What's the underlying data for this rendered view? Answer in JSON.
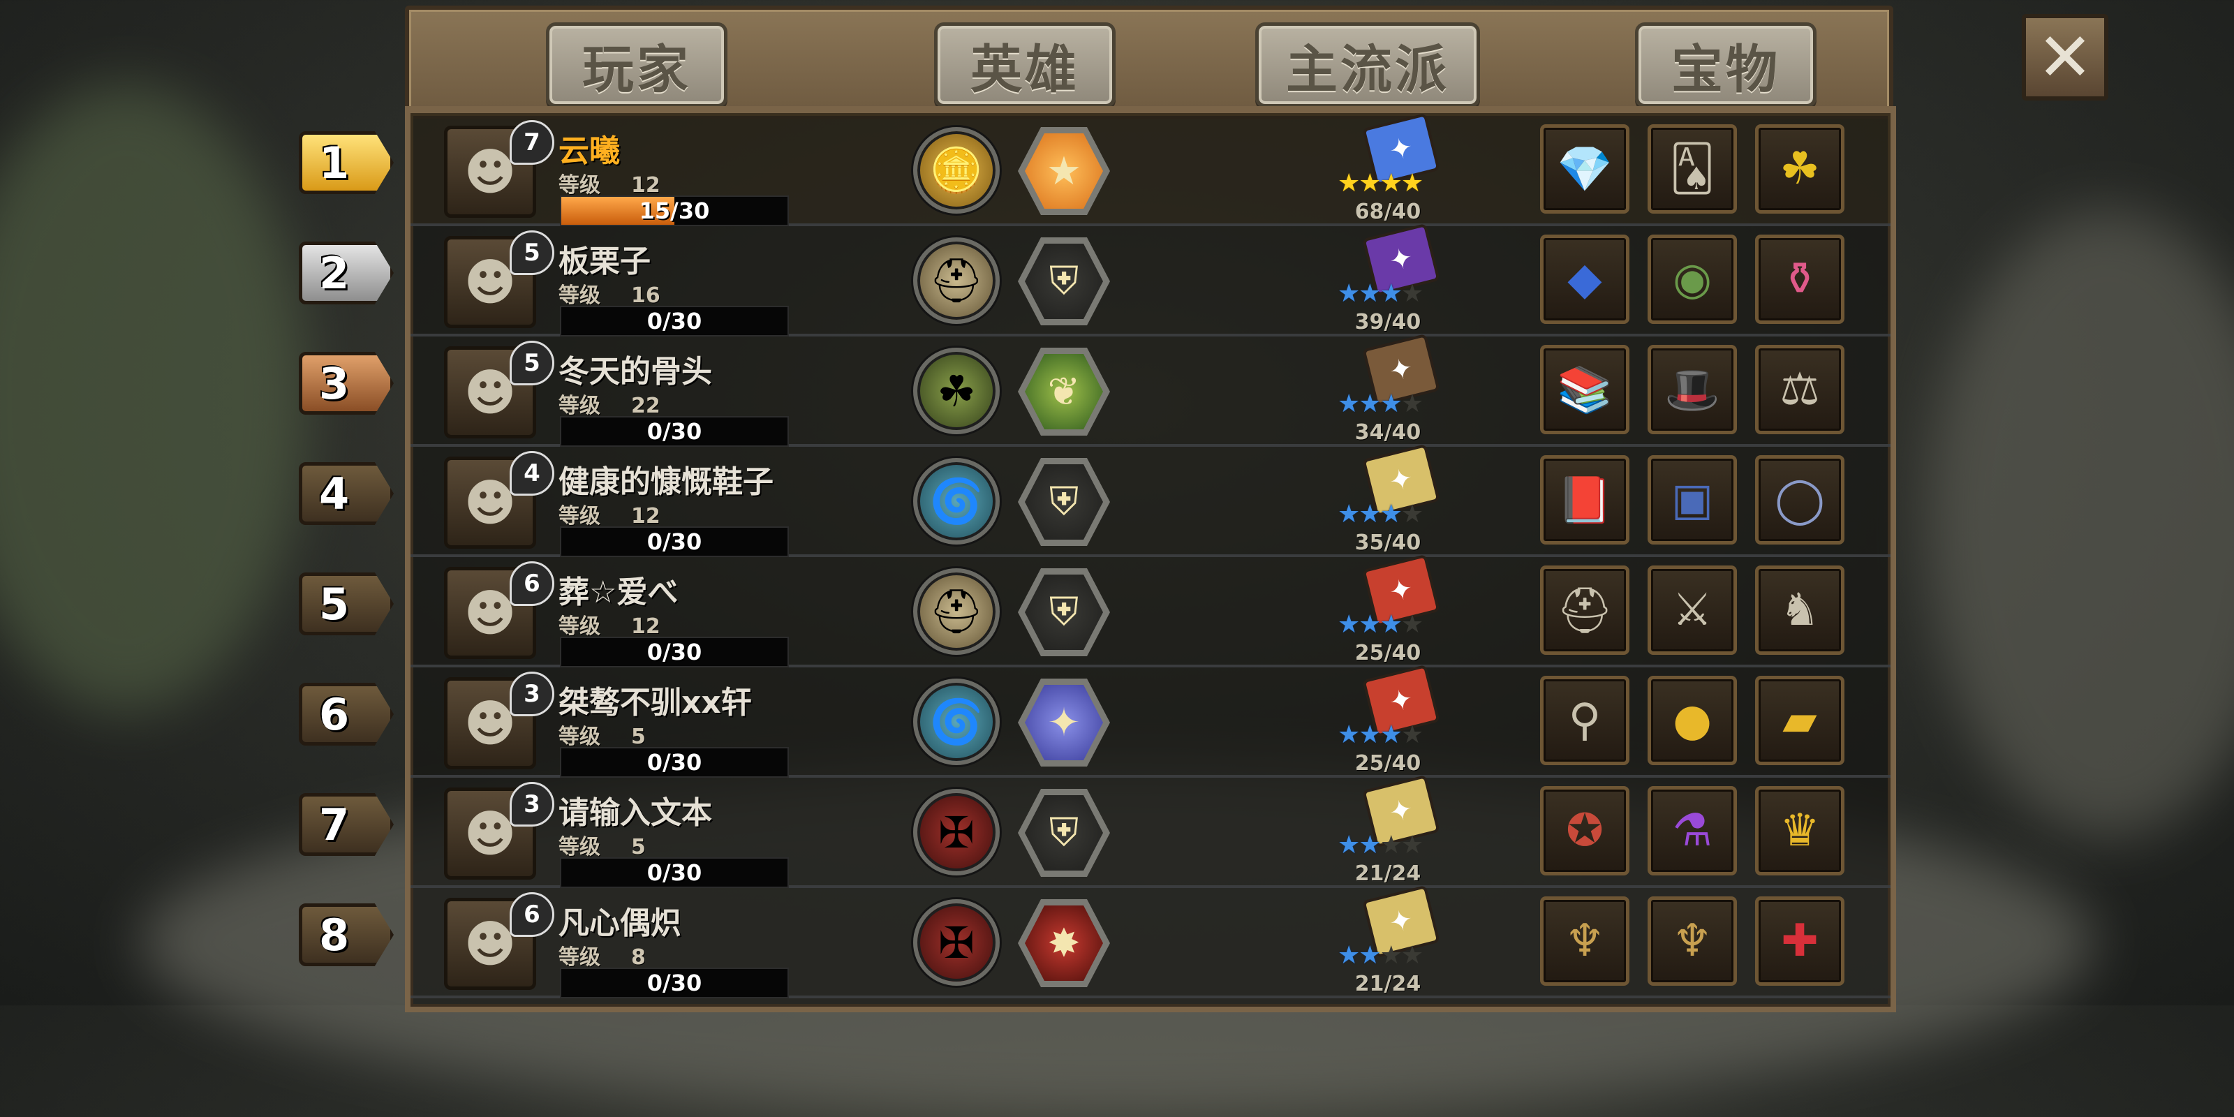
{
  "tabs": [
    {
      "label": "玩家"
    },
    {
      "label": "英雄"
    },
    {
      "label": "主流派"
    },
    {
      "label": "宝物"
    }
  ],
  "close_icon": "close-icon",
  "level_label": "等级",
  "colors": {
    "accent_gold": "#ffb020",
    "xp_fill": "#e57a20",
    "star_gold": "#ffd21e",
    "star_blue": "#3f8fe8"
  },
  "rows": [
    {
      "rank": "1",
      "name": "云曦",
      "avatar_level": "7",
      "level": "12",
      "xp": "15/30",
      "xp_fraction": 0.5,
      "hero_icon": "gold-coins-icon",
      "faction_icon": "gold-coin-hex-icon",
      "book_icon": "blue-book-icon",
      "stars": 4,
      "stars_max": 4,
      "star_color": "gold",
      "progress": "68/40",
      "treasures": [
        "crystal-ore-icon",
        "aces-cards-icon",
        "clover-icon"
      ]
    },
    {
      "rank": "2",
      "name": "板栗子",
      "avatar_level": "5",
      "level": "16",
      "xp": "0/30",
      "xp_fraction": 0,
      "hero_icon": "helmet-icon",
      "faction_icon": "shield-hex-icon",
      "book_icon": "purple-book-icon",
      "stars": 3,
      "stars_max": 4,
      "star_color": "blue",
      "progress": "39/40",
      "treasures": [
        "blue-crystal-icon",
        "green-orb-icon",
        "pink-potion-icon"
      ]
    },
    {
      "rank": "3",
      "name": "冬天的骨头",
      "avatar_level": "5",
      "level": "22",
      "xp": "0/30",
      "xp_fraction": 0,
      "hero_icon": "bone-totem-icon",
      "faction_icon": "nature-hex-icon",
      "book_icon": "brown-book-icon",
      "stars": 3,
      "stars_max": 4,
      "star_color": "blue",
      "progress": "34/40",
      "treasures": [
        "green-books-icon",
        "pirate-hat-icon",
        "scales-icon"
      ]
    },
    {
      "rank": "4",
      "name": "健康的慷慨鞋子",
      "avatar_level": "4",
      "level": "12",
      "xp": "0/30",
      "xp_fraction": 0,
      "hero_icon": "whirlwind-icon",
      "faction_icon": "shield-hex-icon",
      "book_icon": "yellow-book-icon",
      "stars": 3,
      "stars_max": 4,
      "star_color": "blue",
      "progress": "35/40",
      "treasures": [
        "purple-tome-icon",
        "treasure-chest-icon",
        "ring-icon"
      ]
    },
    {
      "rank": "5",
      "name": "葬☆爱べ",
      "avatar_level": "6",
      "level": "12",
      "xp": "0/30",
      "xp_fraction": 0,
      "hero_icon": "helmet-icon",
      "faction_icon": "shield-hex-icon",
      "book_icon": "red-book-icon",
      "stars": 3,
      "stars_max": 4,
      "star_color": "blue",
      "progress": "25/40",
      "treasures": [
        "knight-helm-icon",
        "dark-sword-icon",
        "horned-helm-icon"
      ]
    },
    {
      "rank": "6",
      "name": "桀骜不驯xx轩",
      "avatar_level": "3",
      "level": "5",
      "xp": "0/30",
      "xp_fraction": 0,
      "hero_icon": "whirlwind-icon",
      "faction_icon": "arcane-hex-icon",
      "book_icon": "red-book-icon",
      "stars": 3,
      "stars_max": 4,
      "star_color": "blue",
      "progress": "25/40",
      "treasures": [
        "broom-icon",
        "gold-coin-icon",
        "gold-bar-icon"
      ]
    },
    {
      "rank": "7",
      "name": "请输入文本",
      "avatar_level": "3",
      "level": "5",
      "xp": "0/30",
      "xp_fraction": 0,
      "hero_icon": "blood-rune-icon",
      "faction_icon": "shield-hex-icon",
      "book_icon": "yellow-book-icon",
      "stars": 2,
      "stars_max": 4,
      "star_color": "blue",
      "progress": "21/24",
      "treasures": [
        "spell-book-icon",
        "purple-potion-icon",
        "crown-icon"
      ]
    },
    {
      "rank": "8",
      "name": "凡心偶炽",
      "avatar_level": "6",
      "level": "8",
      "xp": "0/30",
      "xp_fraction": 0,
      "hero_icon": "blood-rune-icon",
      "faction_icon": "blood-crystal-hex-icon",
      "book_icon": "yellow-book-icon",
      "stars": 2,
      "stars_max": 4,
      "star_color": "blue",
      "progress": "21/24",
      "treasures": [
        "chalice-icon",
        "chalice-icon",
        "first-aid-kit-icon"
      ]
    }
  ]
}
